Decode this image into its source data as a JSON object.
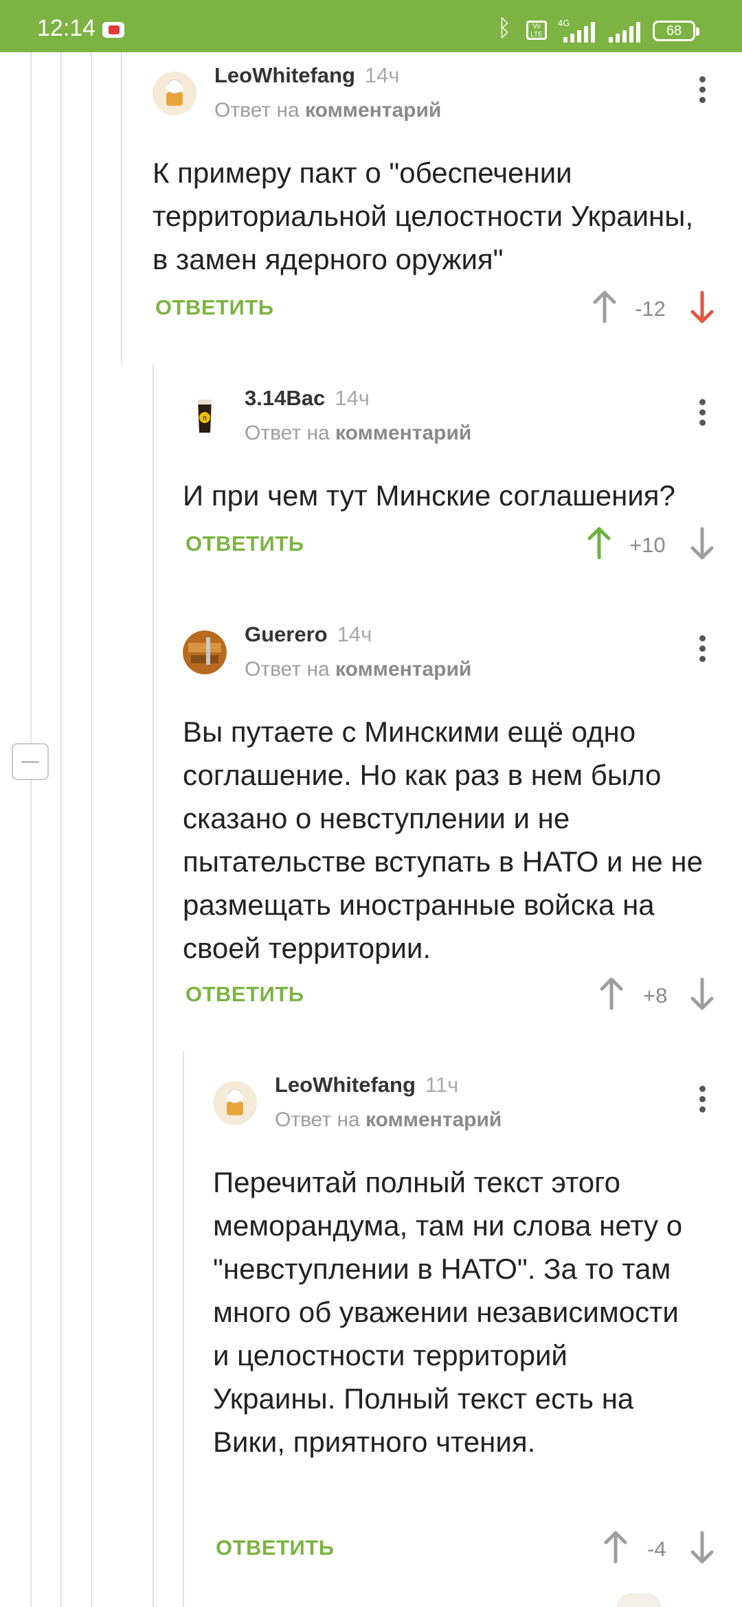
{
  "status_bar": {
    "time": "12:14",
    "battery": "68",
    "network": "4G",
    "volte": "Vo LTE",
    "icons": [
      "youtube-icon",
      "bluetooth-icon",
      "volte-icon",
      "signal-icon",
      "battery-icon"
    ]
  },
  "comments": [
    {
      "author": "LeoWhitefang",
      "time": "14ч",
      "reply_prefix": "Ответ на",
      "reply_link": "комментарий",
      "text": "К примеру пакт о \"обеспечении территориальной целостности Украины, в замен ядерного оружия\"",
      "reply_label": "ОТВЕТИТЬ",
      "rating": "-12",
      "vote": "down"
    },
    {
      "author": "3.14Bac",
      "time": "14ч",
      "reply_prefix": "Ответ на",
      "reply_link": "комментарий",
      "text": "И при чем тут Минские соглашения?",
      "reply_label": "ОТВЕТИТЬ",
      "rating": "+10",
      "vote": "up"
    },
    {
      "author": "Guerero",
      "time": "14ч",
      "reply_prefix": "Ответ на",
      "reply_link": "комментарий",
      "text": "Вы путаете с Минскими ещё одно соглашение. Но как раз в нем было сказано о невступлении и не пытательстве вступать в НАТО и не не размещать иностранные войска на своей территории.",
      "reply_label": "ОТВЕТИТЬ",
      "rating": "+8",
      "vote": "none"
    },
    {
      "author": "LeoWhitefang",
      "time": "11ч",
      "reply_prefix": "Ответ на",
      "reply_link": "комментарий",
      "text": "Перечитай полный текст этого меморандума, там ни слова нету о \"невступлении в НАТО\". За то там много об уважении независимости и целостности территорий Украины. Полный текст есть на Вики, приятного чтения.",
      "reply_label": "ОТВЕТИТЬ",
      "rating": "-4",
      "vote": "none"
    }
  ],
  "colors": {
    "accent": "#7cb342",
    "downvote_active": "#e2543f",
    "upvote_active": "#6db33f",
    "inactive_arrow": "#9e9e9e"
  }
}
